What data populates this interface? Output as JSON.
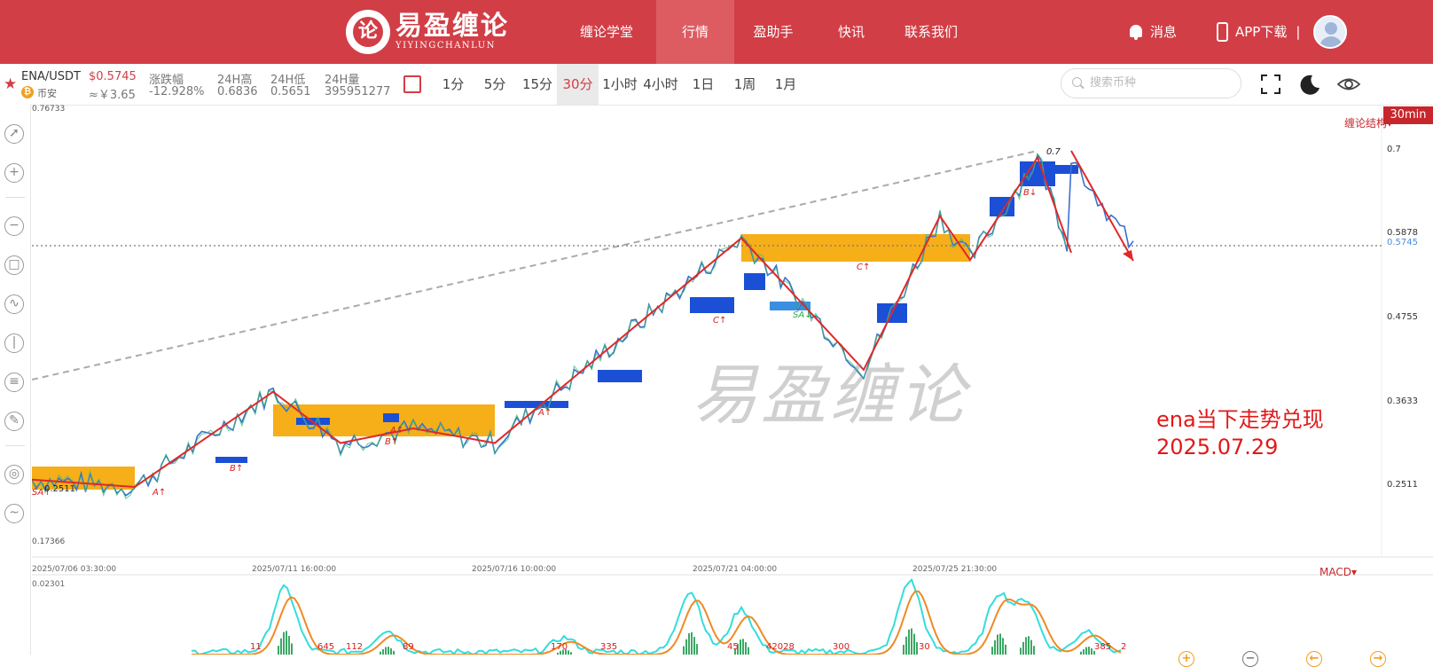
{
  "nav": {
    "logo_cn": "易盈缠论",
    "logo_en": "YIYINGCHANLUN",
    "logo_glyph": "论",
    "items": [
      "缠论学堂",
      "行情",
      "盈助手",
      "快讯",
      "联系我们"
    ],
    "active": "行情",
    "messages": "消息",
    "app_download": "APP下载",
    "divider": "|"
  },
  "ticker": {
    "symbol": "ENA/USDT",
    "price": "$0.5745",
    "exchange": "币安",
    "cny_price": "≈￥3.65",
    "change_label": "涨跌幅",
    "change_value": "-12.928%",
    "high_label": "24H高",
    "high_value": "0.6836",
    "low_label": "24H低",
    "low_value": "0.5651",
    "volume_label": "24H量",
    "volume_value": "395951277",
    "timeframes": [
      "1分",
      "5分",
      "15分",
      "30分",
      "1小时",
      "4小时",
      "1日",
      "1周",
      "1月"
    ],
    "active_timeframe": "30分",
    "search_placeholder": "搜索币种"
  },
  "chart": {
    "structure_button": "缠论结构▾",
    "period_badge": "30min",
    "price_labels": [
      "0.76733",
      "0.7",
      "0.5878",
      "0.5745",
      "0.4755",
      "0.3633",
      "0.2511",
      "0.17366"
    ],
    "date_labels": [
      "2025/07/06 03:30:00",
      "2025/07/11 16:00:00",
      "2025/07/16 10:00:00",
      "2025/07/21 04:00:00",
      "2025/07/25 21:30:00"
    ],
    "annotation_line1": "ena当下走势兑现",
    "annotation_line2": "2025.07.29",
    "watermark": "易盈缠论",
    "macd_label": "MACD▾",
    "macd_top_value": "0.02301",
    "chart_markers": [
      "SA↑",
      "A↑",
      "B↑",
      "A↑",
      "B↑",
      "A↑",
      "C↑",
      "SA↓",
      "C↑",
      "B↓",
      "0.7",
      "0.2511"
    ],
    "macd_numbers": [
      "11",
      "645",
      "112",
      "89",
      "170",
      "335",
      "45",
      "42028",
      "300",
      "30",
      "385",
      "2"
    ],
    "current_price_color": "#4a90d9",
    "accent": "#d23e46"
  },
  "chart_data": {
    "type": "line",
    "title": "",
    "xlabel": "",
    "ylabel": "",
    "x_ticks": [
      "2025/07/06 03:30:00",
      "2025/07/11 16:00:00",
      "2025/07/16 10:00:00",
      "2025/07/21 04:00:00",
      "2025/07/25 21:30:00"
    ],
    "y_ticks": [
      0.2511,
      0.3633,
      0.4755,
      0.5878,
      0.7
    ],
    "ylim": [
      0.17366,
      0.76733
    ],
    "current_price": 0.5745,
    "bi_strokes": [
      0.26,
      0.25,
      0.38,
      0.31,
      0.33,
      0.31,
      0.59,
      0.41,
      0.62,
      0.56,
      0.7,
      0.57
    ],
    "grid": false
  }
}
